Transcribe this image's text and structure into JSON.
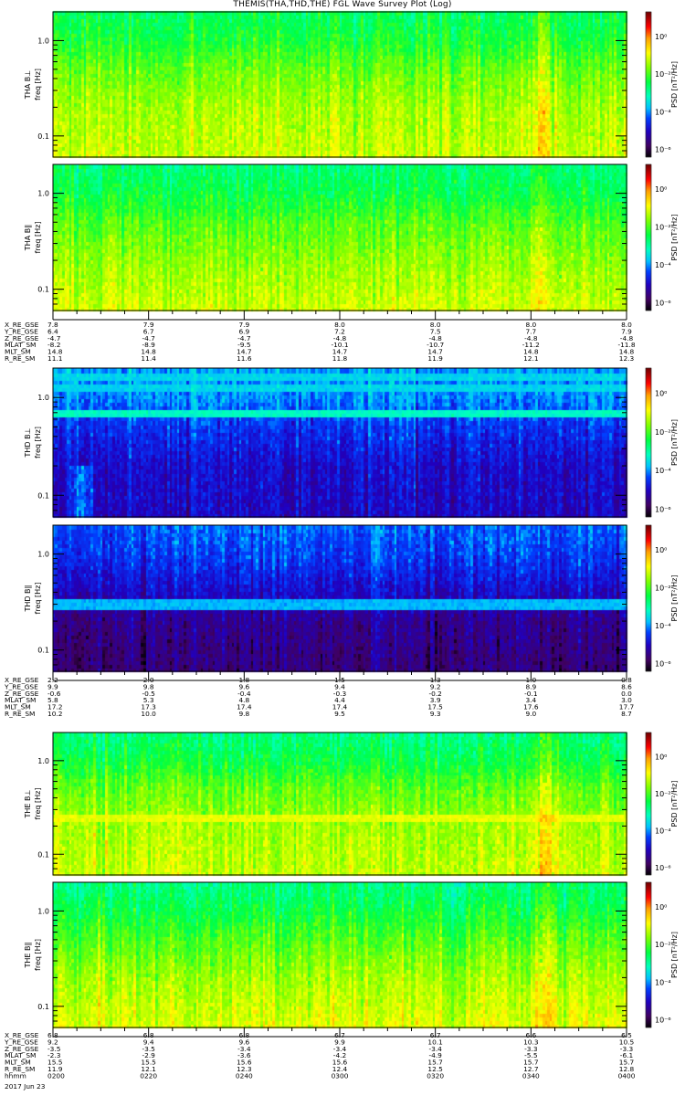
{
  "title": "THEMIS(THA,THD,THE) FGL Wave Survey Plot (Log)",
  "chart_data": {
    "type": "heatmap",
    "title": "THEMIS(THA,THD,THE) FGL Wave Survey Plot (Log)",
    "xlabel": "hhmm",
    "date": "2017 Jun 23",
    "x_ticks": [
      "0200",
      "0220",
      "0240",
      "0300",
      "0320",
      "0340",
      "0400"
    ],
    "x_range_minutes_after_0200": [
      0,
      120
    ],
    "y_scale": "log",
    "y_range_hz": [
      0.06,
      2.0
    ],
    "y_tick_labels": [
      "1.0",
      "0.1"
    ],
    "y_tick_values": [
      1.0,
      0.1
    ],
    "colorbar": {
      "label": "PSD [nT²/Hz]",
      "scale": "log",
      "range_log10": [
        -6.4,
        1.3
      ],
      "tick_labels": [
        "10⁰",
        "10⁻²",
        "10⁻⁴",
        "10⁻⁶"
      ],
      "tick_values_log10": [
        0,
        -2,
        -4,
        -6
      ]
    },
    "panels": [
      {
        "probe": "THA",
        "component": "THA B⊥",
        "ylabel": "freq [Hz]",
        "profile_hz": [
          2.0,
          1.0,
          0.5,
          0.2,
          0.06
        ],
        "profile_log10_psd": [
          -2.6,
          -2.3,
          -1.8,
          -1.4,
          -1.2
        ],
        "lines": [],
        "events": [
          {
            "t_min": 102,
            "log10_boost": 0.8
          }
        ]
      },
      {
        "probe": "THA",
        "component": "THA B∥",
        "ylabel": "freq [Hz]",
        "profile_hz": [
          2.0,
          1.0,
          0.5,
          0.2,
          0.06
        ],
        "profile_log10_psd": [
          -2.7,
          -2.4,
          -1.9,
          -1.5,
          -1.1
        ],
        "lines": [],
        "events": [
          {
            "t_min": 102,
            "log10_boost": 0.6
          }
        ]
      },
      {
        "probe": "THD",
        "component": "THD B⊥",
        "ylabel": "freq [Hz]",
        "profile_hz": [
          2.0,
          1.0,
          0.5,
          0.2,
          0.06
        ],
        "profile_log10_psd": [
          -3.9,
          -4.0,
          -4.5,
          -4.9,
          -5.0
        ],
        "lines": [
          {
            "hz": 0.7,
            "log10_psd": -3.2
          },
          {
            "hz": 1.3,
            "log10_psd": -3.6
          },
          {
            "hz": 1.7,
            "log10_psd": -3.6
          }
        ],
        "events": [
          {
            "t_min": 6,
            "log10_boost": 1.3,
            "low_freq_only": true
          }
        ]
      },
      {
        "probe": "THD",
        "component": "THD B∥",
        "ylabel": "freq [Hz]",
        "profile_hz": [
          2.0,
          1.0,
          0.5,
          0.2,
          0.06
        ],
        "profile_log10_psd": [
          -4.2,
          -4.4,
          -4.8,
          -5.4,
          -5.6
        ],
        "lines": [
          {
            "hz": 0.3,
            "log10_psd": -3.8
          }
        ],
        "events": []
      },
      {
        "probe": "THE",
        "component": "THE B⊥",
        "ylabel": "freq [Hz]",
        "profile_hz": [
          2.0,
          1.0,
          0.5,
          0.2,
          0.06
        ],
        "profile_log10_psd": [
          -2.8,
          -2.4,
          -1.8,
          -1.4,
          -1.2
        ],
        "lines": [
          {
            "hz": 0.25,
            "log10_psd": -1.0
          }
        ],
        "events": [
          {
            "t_min": 103,
            "log10_boost": 1.0
          }
        ]
      },
      {
        "probe": "THE",
        "component": "THE B∥",
        "ylabel": "freq [Hz]",
        "profile_hz": [
          2.0,
          1.0,
          0.5,
          0.2,
          0.06
        ],
        "profile_log10_psd": [
          -2.8,
          -2.4,
          -1.9,
          -1.4,
          -1.0
        ],
        "lines": [],
        "events": [
          {
            "t_min": 103,
            "log10_boost": 0.6
          }
        ]
      }
    ]
  },
  "ephemeris": [
    {
      "probe": "THA",
      "rows": [
        {
          "label": "X_RE_GSE",
          "values": [
            "7.8",
            "7.9",
            "7.9",
            "8.0",
            "8.0",
            "8.0",
            "8.0"
          ]
        },
        {
          "label": "Y_RE_GSE",
          "values": [
            "6.4",
            "6.7",
            "6.9",
            "7.2",
            "7.5",
            "7.7",
            "7.9"
          ]
        },
        {
          "label": "Z_RE_GSE",
          "values": [
            "-4.7",
            "-4.7",
            "-4.7",
            "-4.8",
            "-4.8",
            "-4.8",
            "-4.8"
          ]
        },
        {
          "label": "MLAT_SM",
          "values": [
            "-8.2",
            "-8.9",
            "-9.5",
            "-10.1",
            "-10.7",
            "-11.2",
            "-11.8"
          ]
        },
        {
          "label": "MLT_SM",
          "values": [
            "14.8",
            "14.8",
            "14.7",
            "14.7",
            "14.7",
            "14.8",
            "14.8"
          ]
        },
        {
          "label": "R_RE_SM",
          "values": [
            "11.1",
            "11.4",
            "11.6",
            "11.8",
            "11.9",
            "12.1",
            "12.3"
          ]
        }
      ]
    },
    {
      "probe": "THD",
      "rows": [
        {
          "label": "X_RE_GSE",
          "values": [
            "2.2",
            "2.0",
            "1.8",
            "1.5",
            "1.3",
            "1.0",
            "0.8"
          ]
        },
        {
          "label": "Y_RE_GSE",
          "values": [
            "9.9",
            "9.8",
            "9.6",
            "9.4",
            "9.2",
            "8.9",
            "8.6"
          ]
        },
        {
          "label": "Z_RE_GSE",
          "values": [
            "-0.6",
            "-0.5",
            "-0.4",
            "-0.3",
            "-0.2",
            "-0.1",
            "0.0"
          ]
        },
        {
          "label": "MLAT_SM",
          "values": [
            "5.8",
            "5.3",
            "4.8",
            "4.4",
            "3.9",
            "3.4",
            "3.0"
          ]
        },
        {
          "label": "MLT_SM",
          "values": [
            "17.2",
            "17.3",
            "17.4",
            "17.4",
            "17.5",
            "17.6",
            "17.7"
          ]
        },
        {
          "label": "R_RE_SM",
          "values": [
            "10.2",
            "10.0",
            "9.8",
            "9.5",
            "9.3",
            "9.0",
            "8.7"
          ]
        }
      ]
    },
    {
      "probe": "THE",
      "rows": [
        {
          "label": "X_RE_GSE",
          "values": [
            "6.8",
            "6.8",
            "6.8",
            "6.7",
            "6.7",
            "6.6",
            "6.5"
          ]
        },
        {
          "label": "Y_RE_GSE",
          "values": [
            "9.2",
            "9.4",
            "9.6",
            "9.9",
            "10.1",
            "10.3",
            "10.5"
          ]
        },
        {
          "label": "Z_RE_GSE",
          "values": [
            "-3.5",
            "-3.5",
            "-3.4",
            "-3.4",
            "-3.4",
            "-3.3",
            "-3.3"
          ]
        },
        {
          "label": "MLAT_SM",
          "values": [
            "-2.3",
            "-2.9",
            "-3.6",
            "-4.2",
            "-4.9",
            "-5.5",
            "-6.1"
          ]
        },
        {
          "label": "MLT_SM",
          "values": [
            "15.5",
            "15.5",
            "15.6",
            "15.6",
            "15.7",
            "15.7",
            "15.7"
          ]
        },
        {
          "label": "R_RE_SM",
          "values": [
            "11.9",
            "12.1",
            "12.3",
            "12.4",
            "12.5",
            "12.7",
            "12.8"
          ]
        },
        {
          "label": "hhmm",
          "values": [
            "0200",
            "0220",
            "0240",
            "0300",
            "0320",
            "0340",
            "0400"
          ]
        }
      ]
    }
  ]
}
